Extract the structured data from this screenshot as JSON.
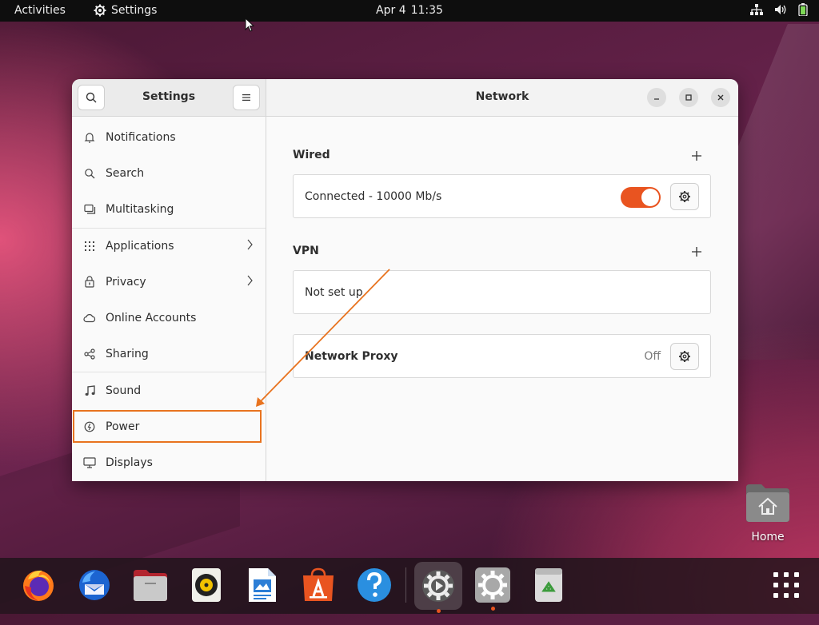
{
  "topbar": {
    "activities": "Activities",
    "app_name": "Settings",
    "date": "Apr 4",
    "time": "11:35"
  },
  "window": {
    "sidebar_title": "Settings",
    "panel_title": "Network"
  },
  "sidebar": {
    "items": [
      {
        "label": "Notifications",
        "icon": "bell-icon"
      },
      {
        "label": "Search",
        "icon": "search-icon"
      },
      {
        "label": "Multitasking",
        "icon": "multitasking-icon"
      },
      {
        "label": "Applications",
        "icon": "grid-icon"
      },
      {
        "label": "Privacy",
        "icon": "lock-icon"
      },
      {
        "label": "Online Accounts",
        "icon": "cloud-icon"
      },
      {
        "label": "Sharing",
        "icon": "share-icon"
      },
      {
        "label": "Sound",
        "icon": "music-note-icon"
      },
      {
        "label": "Power",
        "icon": "power-icon"
      },
      {
        "label": "Displays",
        "icon": "display-icon"
      }
    ]
  },
  "network": {
    "wired_label": "Wired",
    "wired_status": "Connected - 10000 Mb/s",
    "wired_enabled": true,
    "vpn_label": "VPN",
    "vpn_status": "Not set up",
    "proxy_label": "Network Proxy",
    "proxy_value": "Off"
  },
  "desktop": {
    "home_label": "Home"
  },
  "dock": {
    "apps": [
      "firefox-icon",
      "thunderbird-icon",
      "files-icon",
      "rhythmbox-icon",
      "writer-icon",
      "software-icon",
      "help-icon",
      "settings-active-icon",
      "settings-icon",
      "trash-icon",
      "show-apps-icon"
    ]
  },
  "colors": {
    "accent": "#e95420",
    "highlight": "#e8731f"
  }
}
